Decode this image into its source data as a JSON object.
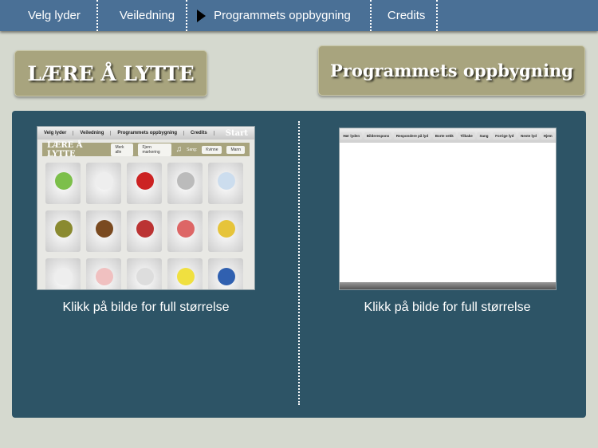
{
  "topbar": {
    "items": [
      "Velg lyder",
      "Veiledning",
      "Programmets oppbygning",
      "Credits"
    ],
    "active": 2
  },
  "buttons": {
    "left": "LÆRE Å LYTTE",
    "right": "Programmets oppbygning"
  },
  "thumb1": {
    "nav": [
      "Velg lyder",
      "Veiledning",
      "Programmets oppbygning",
      "Credits"
    ],
    "start": "Start",
    "title": "LÆRE Å LYTTE",
    "b1": "Merk alle",
    "b2": "Fjern markering",
    "sang": "Sang:",
    "b3": "Kvinne",
    "b4": "Mann",
    "tile_colors": [
      "#7cbf4a",
      "#eee",
      "#c22",
      "#bbb",
      "#cde",
      "#8a8a30",
      "#7a4a20",
      "#b33",
      "#d66",
      "#e6c43a",
      "#eee",
      "#f0c0c0",
      "#ddd",
      "#f0e040",
      "#3060b0"
    ]
  },
  "thumb2": {
    "nav": [
      "Hør lyden",
      "Bilderespons",
      "Respondere på lyd",
      "Borte vekk",
      "Tilbake",
      "Sang",
      "Forrige lyd",
      "Neste lyd",
      "Hjem"
    ]
  },
  "caption": "Klikk på bilde for full størrelse",
  "colors": {
    "topbar": "#4a7096",
    "panel": "#2d5466",
    "button": "#a8a47e",
    "background": "#d5d9cf"
  }
}
